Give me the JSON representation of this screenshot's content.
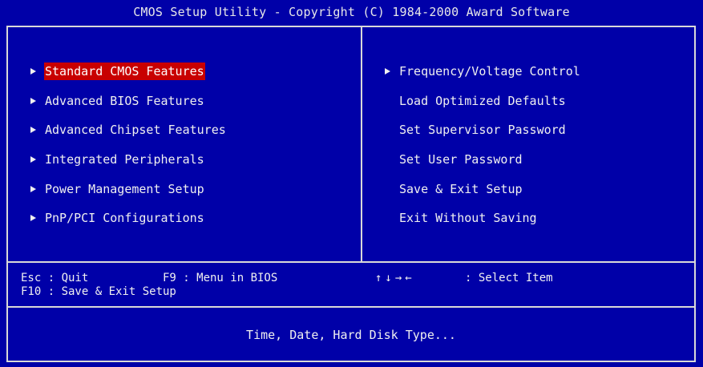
{
  "title": "CMOS Setup Utility - Copyright (C) 1984-2000 Award Software",
  "left_menu": [
    {
      "label": "Standard CMOS Features",
      "has_submenu": true,
      "selected": true
    },
    {
      "label": "Advanced BIOS Features",
      "has_submenu": true,
      "selected": false
    },
    {
      "label": "Advanced Chipset Features",
      "has_submenu": true,
      "selected": false
    },
    {
      "label": "Integrated Peripherals",
      "has_submenu": true,
      "selected": false
    },
    {
      "label": "Power Management Setup",
      "has_submenu": true,
      "selected": false
    },
    {
      "label": "PnP/PCI Configurations",
      "has_submenu": true,
      "selected": false
    }
  ],
  "right_menu": [
    {
      "label": "Frequency/Voltage Control",
      "has_submenu": true
    },
    {
      "label": "Load Optimized Defaults",
      "has_submenu": false
    },
    {
      "label": "Set Supervisor Password",
      "has_submenu": false
    },
    {
      "label": "Set User Password",
      "has_submenu": false
    },
    {
      "label": "Save & Exit Setup",
      "has_submenu": false
    },
    {
      "label": "Exit Without Saving",
      "has_submenu": false
    }
  ],
  "help": {
    "esc": "Esc : Quit",
    "f9": "F9 : Menu in BIOS",
    "nav_arrows": "↑↓→←",
    "nav_action": ": Select Item",
    "f10": "F10 : Save & Exit Setup"
  },
  "status_text": "Time, Date, Hard Disk Type...",
  "colors": {
    "background": "#0000a8",
    "foreground": "#f0f0f0",
    "selection": "#c80000",
    "border": "#d8d8d8"
  }
}
